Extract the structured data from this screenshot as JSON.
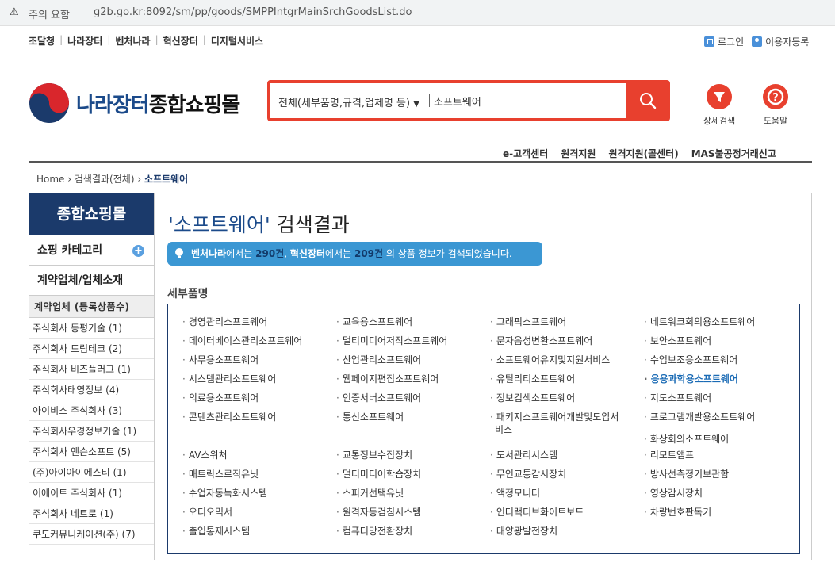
{
  "browser": {
    "warning": "주의 요함",
    "url": "g2b.go.kr:8092/sm/pp/goods/SMPPIntgrMainSrchGoodsList.do"
  },
  "top_links": [
    "조달청",
    "나라장터",
    "벤처나라",
    "혁신장터",
    "디지털서비스"
  ],
  "account": {
    "login": "로그인",
    "register": "이용자등록"
  },
  "logo": {
    "part1": "나라장터",
    "part2": "종합쇼핑몰"
  },
  "search": {
    "category": "전체(세부품명,규격,업체명 등)",
    "value": "소프트웨어"
  },
  "tools": {
    "detail_search": "상세검색",
    "help": "도움말"
  },
  "sub_links": [
    "e-고객센터",
    "원격지원",
    "원격지원(콜센터)",
    "MAS불공정거래신고"
  ],
  "breadcrumb": {
    "home": "Home",
    "mid": "검색결과(전체)",
    "current": "소프트웨어"
  },
  "sidebar": {
    "title": "종합쇼핑몰",
    "menus": [
      "쇼핑 카테고리",
      "계약업체/업체소재"
    ],
    "sub_title": "계약업체 (등록상품수)",
    "items": [
      "주식회사 동평기술 (1)",
      "주식회사 드림테크 (2)",
      "주식회사 비즈플러그 (1)",
      "주식회사태영정보 (4)",
      "아이비스 주식회사 (3)",
      "주식회사우경정보기술 (1)",
      "주식회사 엔슨소프트 (5)",
      "(주)아이아이에스티 (1)",
      "이에이트 주식회사 (1)",
      "주식회사 네트로 (1)",
      "쿠도커뮤니케이션(주) (7)"
    ]
  },
  "result": {
    "keyword": "'소프트웨어'",
    "suffix": "검색결과",
    "notice": {
      "venture": "벤처나라",
      "t1": "에서는",
      "venture_count": "290건",
      "innov": "혁신장터",
      "t2": "에서는",
      "innov_count": "209건",
      "t3": "의 상품 정보가 검색되었습니다."
    }
  },
  "section_title": "세부품명",
  "categories_group1": [
    [
      "경영관리소프트웨어",
      "교육용소프트웨어",
      "그래픽소프트웨어",
      "네트워크회의용소프트웨어"
    ],
    [
      "데이터베이스관리소프트웨어",
      "멀티미디어저작소프트웨어",
      "문자음성변환소프트웨어",
      "보안소프트웨어"
    ],
    [
      "사무용소프트웨어",
      "산업관리소프트웨어",
      "소프트웨어유지및지원서비스",
      "수업보조용소프트웨어"
    ],
    [
      "시스템관리소프트웨어",
      "웹페이지편집소프트웨어",
      "유틸리티소프트웨어",
      "응용과학용소프트웨어"
    ],
    [
      "의료용소프트웨어",
      "인증서버소프트웨어",
      "정보검색소프트웨어",
      "지도소프트웨어"
    ],
    [
      "콘텐츠관리소프트웨어",
      "통신소프트웨어",
      "패키지소프트웨어개발및도입서",
      "프로그램개발용소프트웨어"
    ]
  ],
  "category_wrap": "비스",
  "category_extra": "화상회의소프트웨어",
  "categories_group2": [
    [
      "AV스위처",
      "교통정보수집장치",
      "도서관리시스템",
      "리모트앰프"
    ],
    [
      "매트릭스로직유닛",
      "멀티미디어학습장치",
      "무인교통감시장치",
      "방사선측정기보관함"
    ],
    [
      "수업자동녹화시스템",
      "스피커선택유닛",
      "액정모니터",
      "영상감시장치"
    ],
    [
      "오디오믹서",
      "원격자동검침시스템",
      "인터랙티브화이트보드",
      "차량번호판독기"
    ],
    [
      "출입통제시스템",
      "컴퓨터망전환장치",
      "태양광발전장치"
    ]
  ],
  "highlighted_category": "응용과학용소프트웨어"
}
